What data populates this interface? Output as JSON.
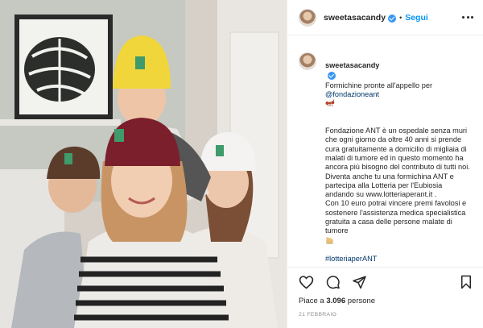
{
  "post": {
    "username": "sweetasacandy",
    "separator": "•",
    "follow_label": "Segui"
  },
  "caption": {
    "username": "sweetasacandy",
    "intro": "Formichine pronte all'appello per ",
    "mention": "@fondazioneant",
    "body": "Fondazione ANT è un ospedale senza muri che ogni giorno da oltre 40 anni si prende cura gratuitamente a domicilio di migliaia di malati di tumore ed in questo momento ha ancora più bisogno del contributo di tutti noi.\nDiventa anche tu una formichina ANT e partecipa alla Lotteria per l'Eubiosia andando su www.lotteriaperant.it .\nCon 10 euro potrai vincere premi favolosi e\nsostenere l'assistenza medica specialistica gratuita a casa delle persone malate di tumore",
    "hashtag": "#lotteriaperANT"
  },
  "footer": {
    "likes_prefix": "Piace a ",
    "likes_count": "3.096",
    "likes_suffix": " persone",
    "date": "21 FEBBRAIO"
  },
  "icons": {
    "verified": "verified-badge-icon",
    "more": "more-options-icon",
    "ant_emoji": "ant-emoji-icon",
    "caption_end_emoji": "ant-emoji-icon",
    "like": "heart-icon",
    "comment": "comment-icon",
    "share": "paper-plane-icon",
    "save": "bookmark-icon"
  },
  "colors": {
    "link": "#0095f6",
    "hashtag": "#00376b",
    "verified": "#3897f0",
    "muted": "#8e8e8e"
  }
}
